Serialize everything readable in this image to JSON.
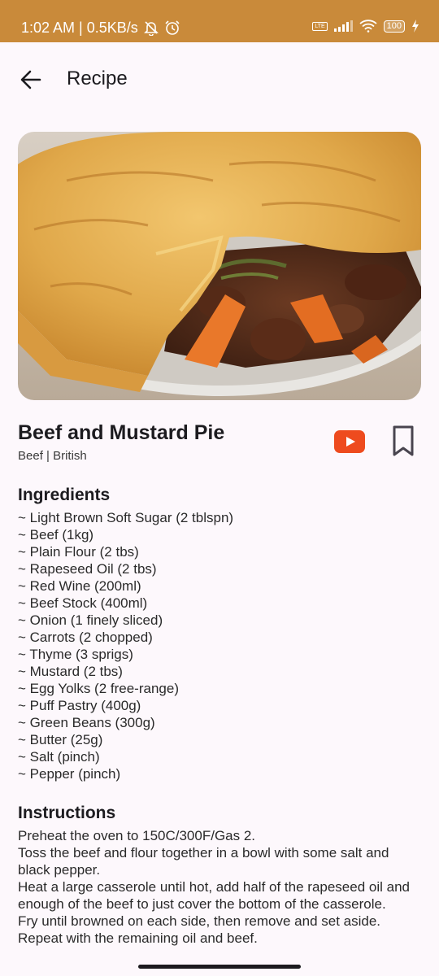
{
  "status_bar": {
    "time_info": "1:02 AM | 0.5KB/s",
    "network": "LTE",
    "battery": "100",
    "icons": [
      "mute-alarm-icon",
      "alarm-icon",
      "lte-icon",
      "signal-icon",
      "wifi-icon",
      "battery-icon",
      "charging-icon"
    ]
  },
  "app_bar": {
    "title": "Recipe",
    "back_icon": "arrow-left-icon"
  },
  "hero_image": {
    "subject": "beef and mustard pie photo"
  },
  "meal": {
    "title": "Beef and Mustard Pie",
    "category_area": "Beef | British",
    "youtube_icon": "youtube-icon",
    "bookmark_icon": "bookmark-outline-icon",
    "accent_color": "#ee4b1e"
  },
  "ingredients": {
    "heading": "Ingredients",
    "items": [
      "~ Light Brown Soft Sugar (2 tblspn)",
      "~ Beef (1kg)",
      "~ Plain Flour (2 tbs)",
      "~ Rapeseed Oil (2 tbs)",
      "~ Red Wine (200ml)",
      "~ Beef Stock (400ml)",
      "~ Onion (1 finely sliced)",
      "~ Carrots (2 chopped)",
      "~ Thyme (3 sprigs)",
      "~ Mustard (2 tbs)",
      "~ Egg Yolks (2 free-range)",
      "~ Puff Pastry (400g)",
      "~ Green Beans (300g)",
      "~ Butter (25g)",
      "~ Salt (pinch)",
      "~ Pepper (pinch)"
    ]
  },
  "instructions": {
    "heading": "Instructions",
    "text": "Preheat the oven to 150C/300F/Gas 2.\nToss the beef and flour together in a bowl with some salt and black pepper.\nHeat a large casserole until hot, add half of the rapeseed oil and enough of the beef to just cover the bottom of the casserole.\nFry until browned on each side, then remove and set aside.\nRepeat with the remaining oil and beef."
  },
  "colors": {
    "status_bar": "#c98a3a",
    "background": "#fdf8fc",
    "text": "#1c1b1f"
  }
}
